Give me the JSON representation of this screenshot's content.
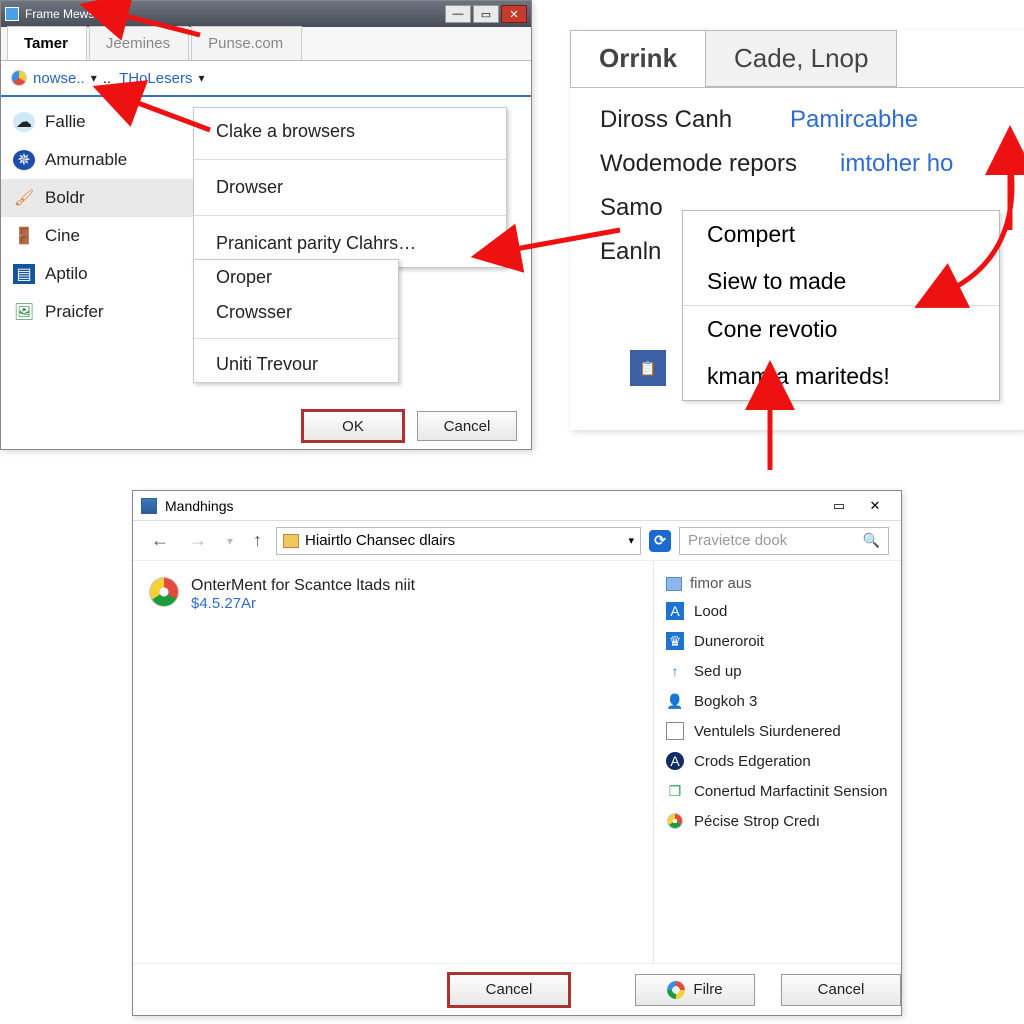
{
  "win1": {
    "title": "Frame Mewsers",
    "tabs": [
      "Tamer",
      "Jeemines",
      "Punse.com"
    ],
    "active_tab": 0,
    "toolbar": {
      "combo1": "nowse..",
      "combo2": "THoLesers"
    },
    "list": [
      {
        "icon_bg": "#4fb8e8",
        "label": "Fallie"
      },
      {
        "icon_bg": "#1d4fa8",
        "label": "Amurnable"
      },
      {
        "icon_bg": "#e27b2e",
        "label": "Boldr",
        "selected": true
      },
      {
        "icon_bg": "#2e6fb8",
        "label": "Cine"
      },
      {
        "icon_bg": "#1254a0",
        "label": "Aptilo"
      },
      {
        "icon_bg": "#2d8a45",
        "label": "Praicfer"
      }
    ],
    "menu_main": [
      "Clake a browsers",
      "Drowser",
      "Pranicant parity Clahrs…"
    ],
    "menu_sub": [
      "Oroper",
      "Crowsser",
      "Uniti Trevour"
    ],
    "buttons": {
      "ok": "OK",
      "cancel": "Cancel"
    }
  },
  "panel2": {
    "tabs": [
      "Orrink",
      "Cade, Lnop"
    ],
    "rows": [
      {
        "label": "Diross Canh",
        "link": "Pamircabhe"
      },
      {
        "label": "Wodemode repors",
        "link": "imtoher ho"
      },
      {
        "label": "Samo",
        "link": ""
      },
      {
        "label": "Eanln",
        "link": ""
      }
    ],
    "cmenu": [
      "Compert",
      "Siew to made",
      "Cone revotio",
      "kmam a mariteds!"
    ]
  },
  "win3": {
    "title": "Mandhings",
    "address": "Hiairtlo Chansec dlairs",
    "search_placeholder": "Pravietce dook",
    "file": {
      "name": "OnterMent for Scantce ltads niit",
      "meta": "$4.5.27Ar"
    },
    "side_header": "fimor aus",
    "side_items": [
      {
        "glyph": "A",
        "bg": "#1e72d0",
        "label": "Lood"
      },
      {
        "glyph": "◔",
        "bg": "#1e72d0",
        "label": "Duneroroit"
      },
      {
        "glyph": "↑",
        "bg": "#1e72d0",
        "label": "Sed up"
      },
      {
        "glyph": "👤",
        "bg": "#1e72d0",
        "label": "Bogkoh 3"
      },
      {
        "glyph": "▢",
        "bg": "#ffffff",
        "label": "Ventulels Siurdenered"
      },
      {
        "glyph": "●",
        "bg": "#122a66",
        "label": "Crods Edgeration"
      },
      {
        "glyph": "❐",
        "bg": "#2e9e5a",
        "label": "Conertud Marfactinit Sension"
      },
      {
        "glyph": "◐",
        "bg": "#e24b3b",
        "label": "Pécise Strop Credı"
      }
    ],
    "footer": {
      "cancel_main": "Cancel",
      "google": "Filre",
      "cancel2": "Cancel"
    }
  }
}
